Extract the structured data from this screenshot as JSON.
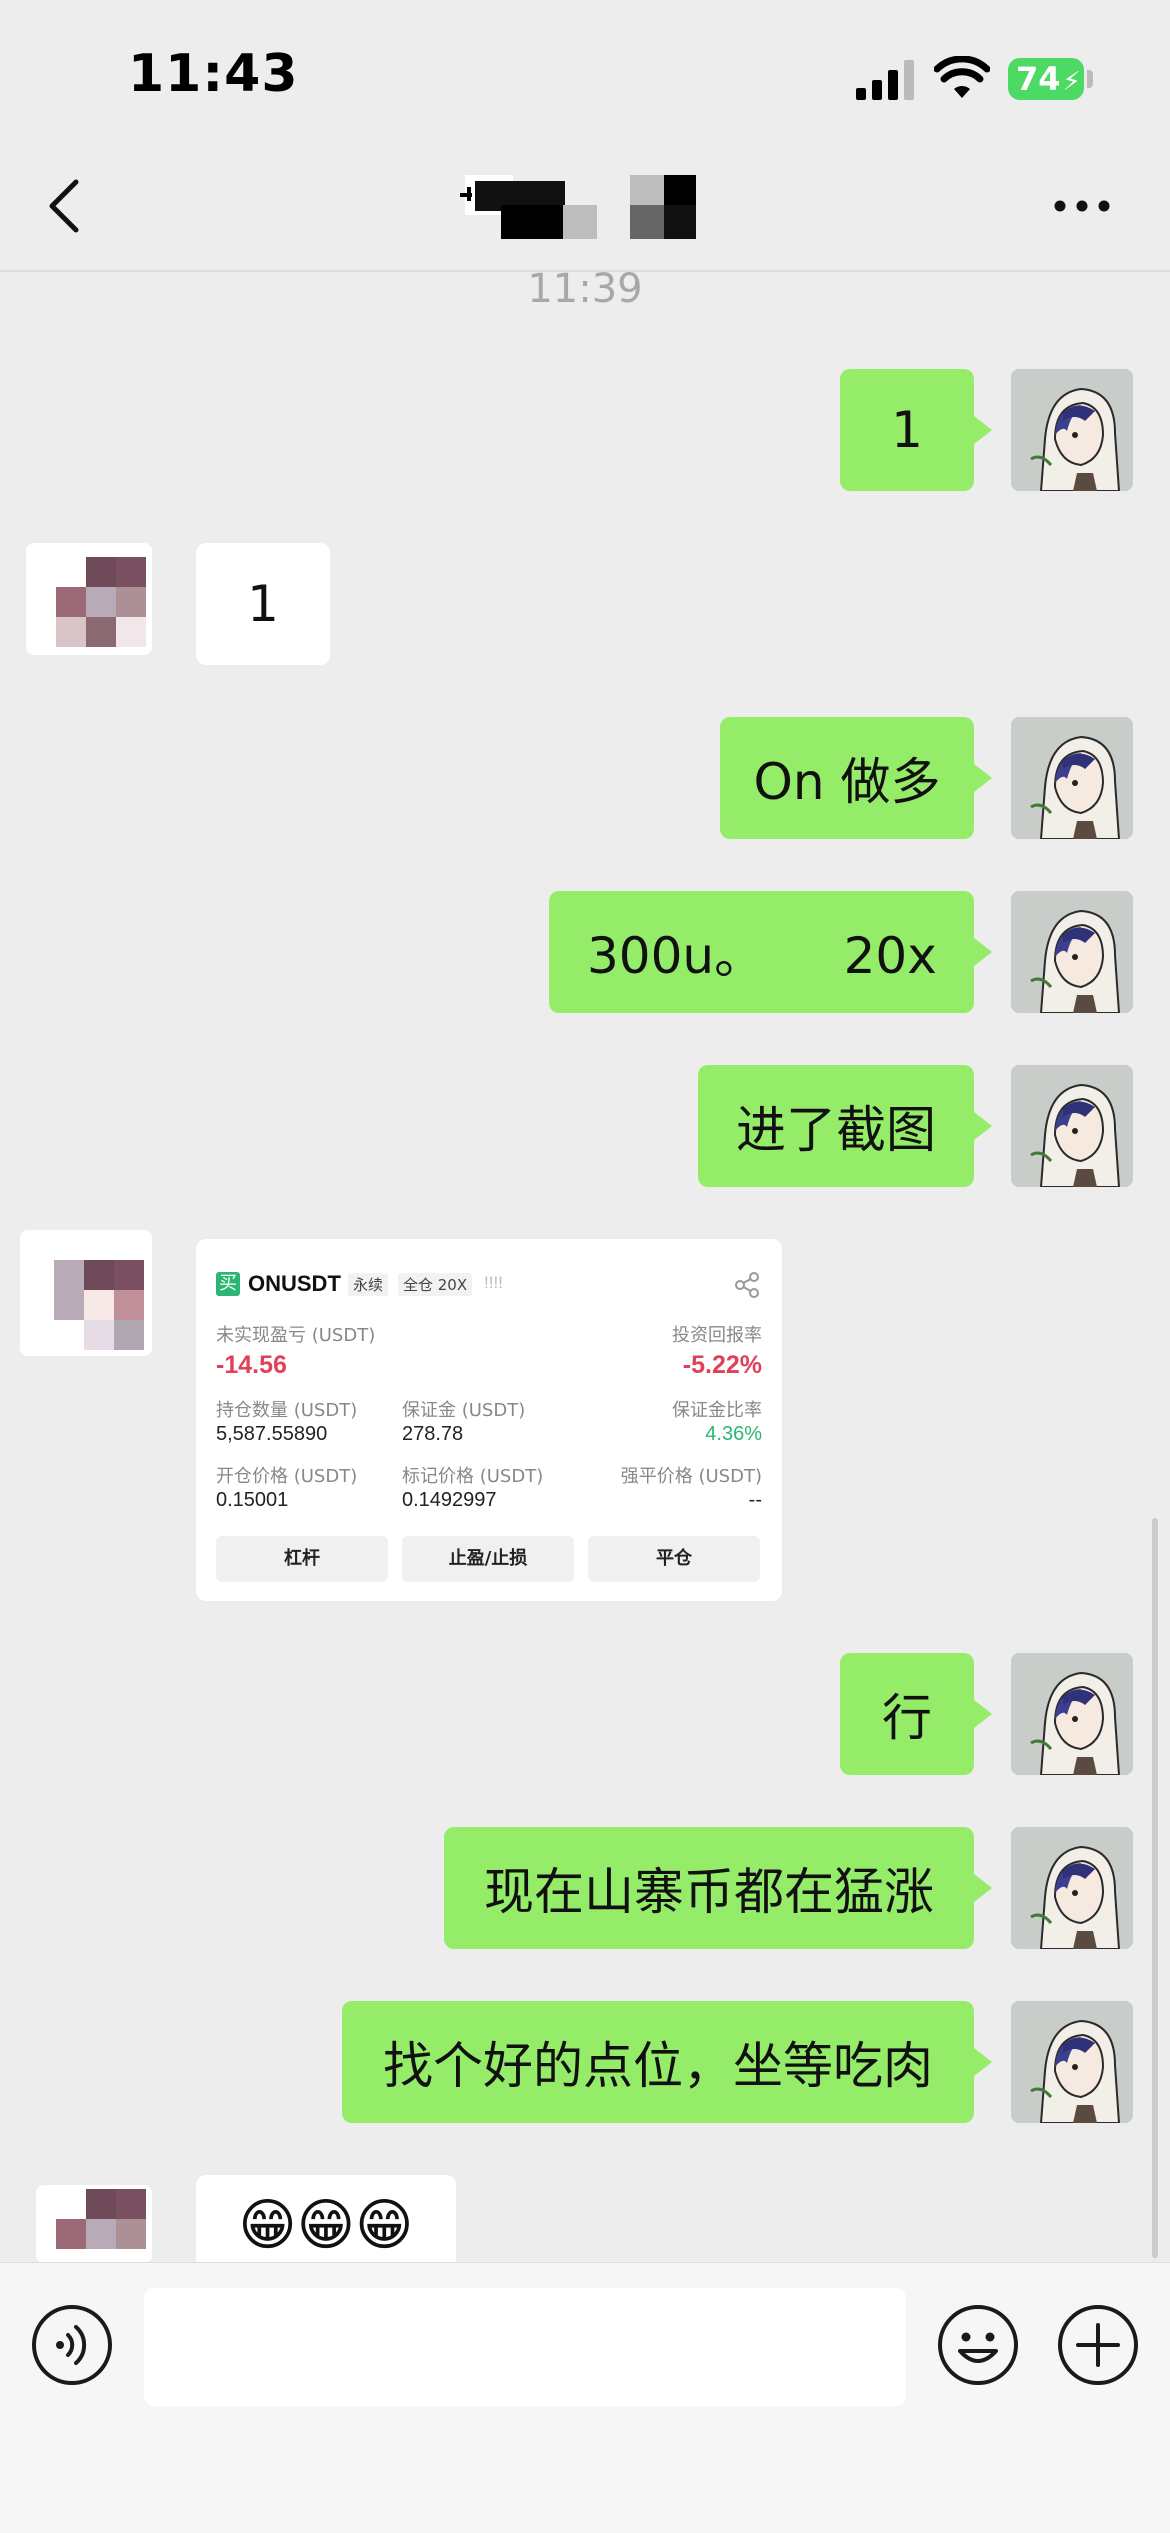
{
  "status_bar": {
    "time": "11:43",
    "battery": "74"
  },
  "chat": {
    "timestamp": "11:39",
    "messages": [
      {
        "from": "me",
        "text": "1"
      },
      {
        "from": "them",
        "text": "1"
      },
      {
        "from": "me",
        "text": "On 做多"
      },
      {
        "from": "me",
        "text": "300u。     20x"
      },
      {
        "from": "me",
        "text": "进了截图"
      },
      {
        "from": "me",
        "text": "行"
      },
      {
        "from": "me",
        "text": "现在山寨币都在猛涨"
      },
      {
        "from": "me",
        "text": "找个好的点位，坐等吃肉"
      },
      {
        "from": "them",
        "text": "😁😁😁"
      }
    ]
  },
  "position_card": {
    "side_badge": "买",
    "symbol": "ONUSDT",
    "tag_perpetual": "永续",
    "tag_margin": "全仓 20X",
    "signal_bars": "!!!!",
    "unrealized_pnl_label": "未实现盈亏 (USDT)",
    "unrealized_pnl_value": "-14.56",
    "roi_label": "投资回报率",
    "roi_value": "-5.22%",
    "size_label": "持仓数量 (USDT)",
    "size_value": "5,587.55890",
    "margin_label": "保证金 (USDT)",
    "margin_value": "278.78",
    "margin_ratio_label": "保证金比率",
    "margin_ratio_value": "4.36%",
    "entry_label": "开仓价格 (USDT)",
    "entry_value": "0.15001",
    "mark_label": "标记价格 (USDT)",
    "mark_value": "0.1492997",
    "liq_label": "强平价格 (USDT)",
    "liq_value": "--",
    "buttons": [
      "杠杆",
      "止盈/止损",
      "平仓"
    ]
  },
  "colors": {
    "bubble_me": "#95ec69",
    "bubble_them": "#ffffff",
    "loss_red": "#e0405a",
    "gain_green": "#2bb673"
  },
  "icons": {
    "back": "chevron-left-icon",
    "more": "more-dots-icon",
    "voice": "voice-icon",
    "emoji": "emoji-icon",
    "plus": "plus-icon"
  }
}
